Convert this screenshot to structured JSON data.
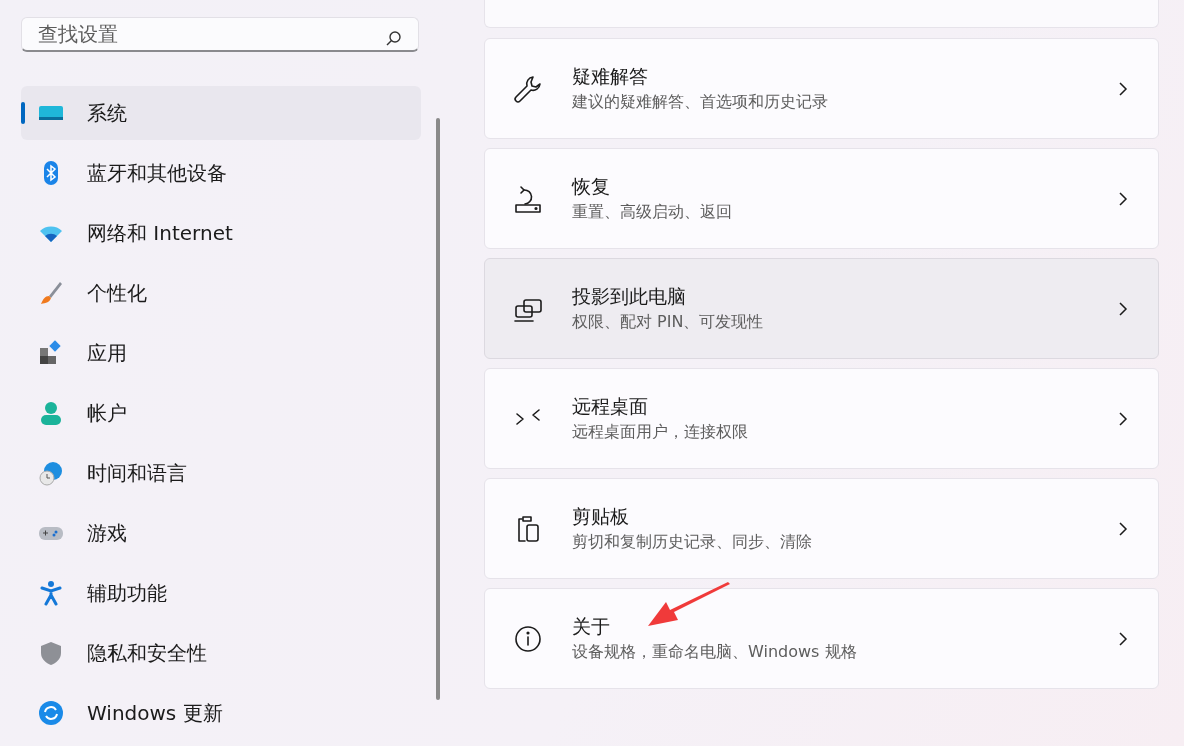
{
  "search": {
    "placeholder": "查找设置"
  },
  "nav": [
    {
      "label": "系统",
      "kind": "system",
      "selected": true
    },
    {
      "label": "蓝牙和其他设备",
      "kind": "bluetooth",
      "selected": false
    },
    {
      "label": "网络和 Internet",
      "kind": "network",
      "selected": false
    },
    {
      "label": "个性化",
      "kind": "brush",
      "selected": false
    },
    {
      "label": "应用",
      "kind": "apps",
      "selected": false
    },
    {
      "label": "帐户",
      "kind": "account",
      "selected": false
    },
    {
      "label": "时间和语言",
      "kind": "time",
      "selected": false
    },
    {
      "label": "游戏",
      "kind": "gaming",
      "selected": false
    },
    {
      "label": "辅助功能",
      "kind": "accessibility",
      "selected": false
    },
    {
      "label": "隐私和安全性",
      "kind": "privacy",
      "selected": false
    },
    {
      "label": "Windows 更新",
      "kind": "update",
      "selected": false
    }
  ],
  "cards": [
    {
      "title": "疑难解答",
      "subtitle": "建议的疑难解答、首选项和历史记录",
      "kind": "wrench",
      "hovered": false
    },
    {
      "title": "恢复",
      "subtitle": "重置、高级启动、返回",
      "kind": "recovery",
      "hovered": false
    },
    {
      "title": "投影到此电脑",
      "subtitle": "权限、配对 PIN、可发现性",
      "kind": "project",
      "hovered": true
    },
    {
      "title": "远程桌面",
      "subtitle": "远程桌面用户，连接权限",
      "kind": "remote",
      "hovered": false
    },
    {
      "title": "剪贴板",
      "subtitle": "剪切和复制历史记录、同步、清除",
      "kind": "clipboard",
      "hovered": false
    },
    {
      "title": "关于",
      "subtitle": "设备规格，重命名电脑、Windows 规格",
      "kind": "info",
      "hovered": false
    }
  ]
}
